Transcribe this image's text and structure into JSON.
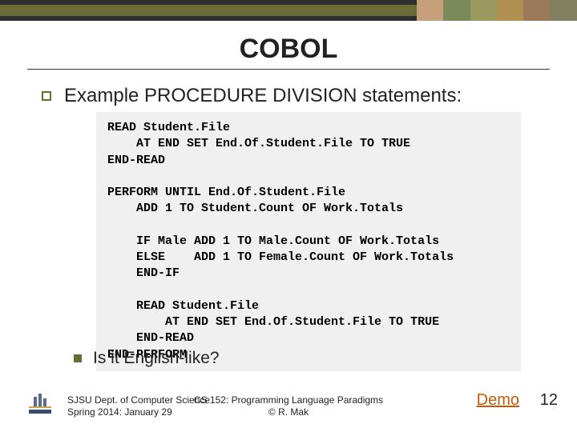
{
  "colors": {
    "bar_dark": "#2f2f2f",
    "bar_olive": "#6b6b38",
    "link": "#c65a0a"
  },
  "title": "COBOL",
  "bullet_main": "Example PROCEDURE DIVISION statements:",
  "code": "READ Student.File\n    AT END SET End.Of.Student.File TO TRUE\nEND-READ\n\nPERFORM UNTIL End.Of.Student.File\n    ADD 1 TO Student.Count OF Work.Totals\n\n    IF Male ADD 1 TO Male.Count OF Work.Totals\n    ELSE    ADD 1 TO Female.Count OF Work.Totals\n    END-IF\n\n    READ Student.File\n        AT END SET End.Of.Student.File TO TRUE\n    END-READ\nEND-PERFORM",
  "bullet_sub": "Is it English-like?",
  "footer": {
    "left_line1": "SJSU Dept. of Computer Science",
    "left_line2": "Spring 2014: January 29",
    "center_line1": "CS 152: Programming Language Paradigms",
    "center_line2": "© R. Mak",
    "demo": "Demo",
    "slide_number": "12"
  }
}
